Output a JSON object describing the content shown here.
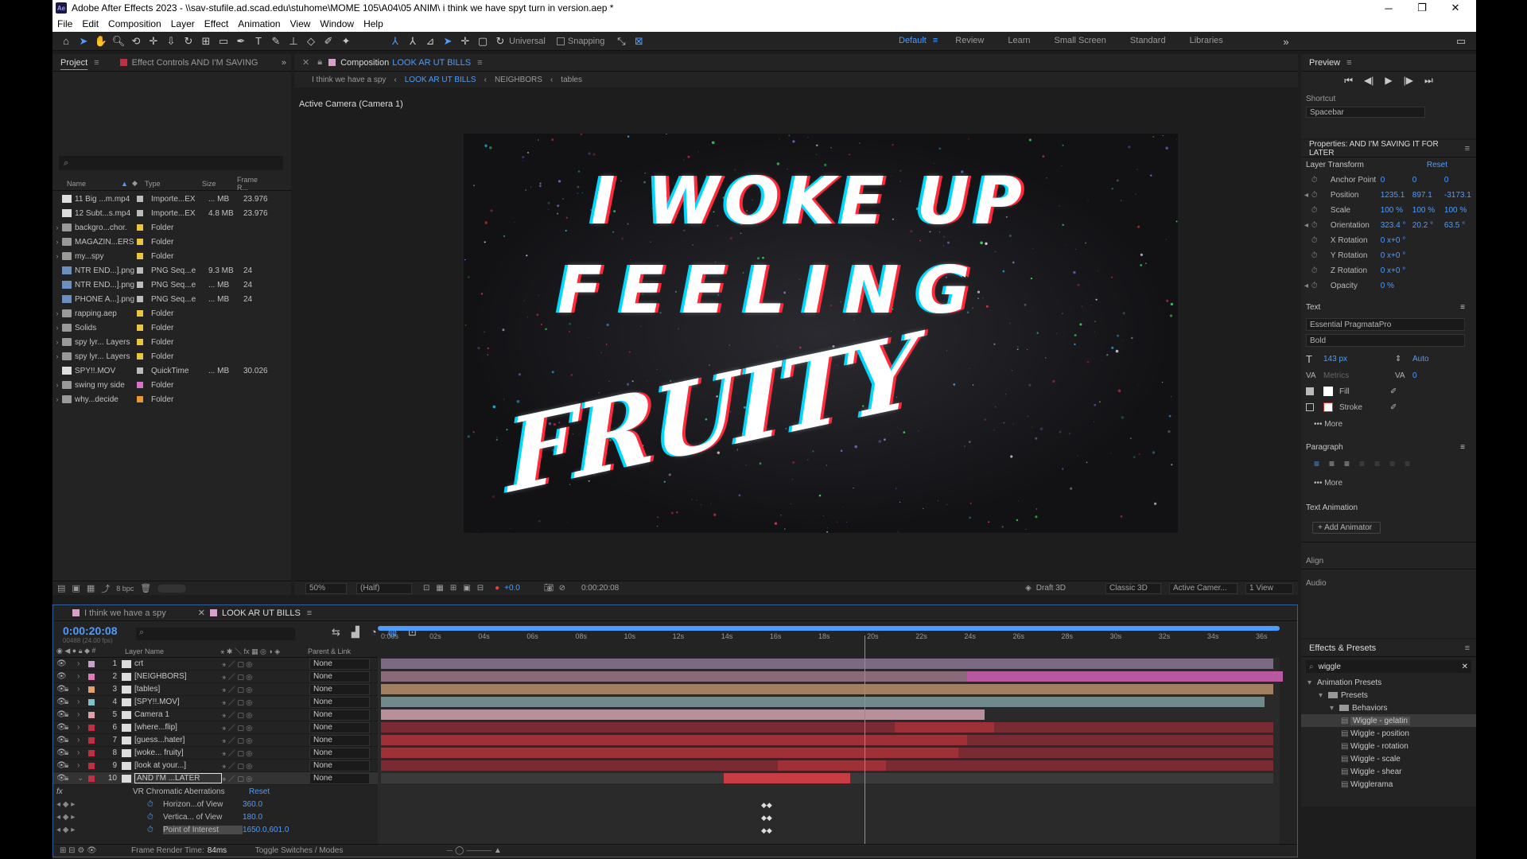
{
  "title": "Adobe After Effects 2023 - \\\\sav-stufile.ad.scad.edu\\stuhome\\MOME 105\\A04\\05 ANIM\\ i think we have spyt turn in version.aep *",
  "menu": [
    "File",
    "Edit",
    "Composition",
    "Layer",
    "Effect",
    "Animation",
    "View",
    "Window",
    "Help"
  ],
  "toolbar": {
    "universal": "Universal",
    "snapping": "Snapping"
  },
  "workspaces": [
    "Default",
    "Review",
    "Learn",
    "Small Screen",
    "Standard",
    "Libraries"
  ],
  "project": {
    "tab_project": "Project",
    "tab_effect": "Effect Controls AND I'M SAVING",
    "cols": {
      "name": "Name",
      "type": "Type",
      "size": "Size",
      "fr": "Frame R..."
    },
    "items": [
      {
        "name": "11 Big ...m.mp4",
        "type": "Importe...EX",
        "size": "... MB",
        "fr": "23.976",
        "kind": "file",
        "color": "#bcbcbc",
        "arrow": ""
      },
      {
        "name": "12 Subt...s.mp4",
        "type": "Importe...EX",
        "size": "4.8 MB",
        "fr": "23.976",
        "kind": "file",
        "color": "#bcbcbc",
        "arrow": ""
      },
      {
        "name": "backgro...chor.",
        "type": "Folder",
        "size": "",
        "fr": "",
        "kind": "folder",
        "color": "#e8c640",
        "arrow": "›"
      },
      {
        "name": "MAGAZIN...ERS",
        "type": "Folder",
        "size": "",
        "fr": "",
        "kind": "folder",
        "color": "#e8c640",
        "arrow": "›"
      },
      {
        "name": "my...spy",
        "type": "Folder",
        "size": "",
        "fr": "",
        "kind": "folder",
        "color": "#e8c640",
        "arrow": "›"
      },
      {
        "name": "NTR END...].png",
        "type": "PNG Seq...e",
        "size": "9.3 MB",
        "fr": "24",
        "kind": "png",
        "color": "#bcbcbc",
        "arrow": ""
      },
      {
        "name": "NTR END...].png",
        "type": "PNG Seq...e",
        "size": "... MB",
        "fr": "24",
        "kind": "png",
        "color": "#bcbcbc",
        "arrow": ""
      },
      {
        "name": "PHONE A...].png",
        "type": "PNG Seq...e",
        "size": "... MB",
        "fr": "24",
        "kind": "png",
        "color": "#bcbcbc",
        "arrow": ""
      },
      {
        "name": "rapping.aep",
        "type": "Folder",
        "size": "",
        "fr": "",
        "kind": "folder",
        "color": "#e8c640",
        "arrow": "›"
      },
      {
        "name": "Solids",
        "type": "Folder",
        "size": "",
        "fr": "",
        "kind": "folder",
        "color": "#e8c640",
        "arrow": "›"
      },
      {
        "name": "spy lyr... Layers",
        "type": "Folder",
        "size": "",
        "fr": "",
        "kind": "folder",
        "color": "#e8c640",
        "arrow": "›"
      },
      {
        "name": "spy lyr... Layers",
        "type": "Folder",
        "size": "",
        "fr": "",
        "kind": "folder",
        "color": "#e8c640",
        "arrow": "›"
      },
      {
        "name": "SPY!!.MOV",
        "type": "QuickTime",
        "size": "... MB",
        "fr": "30.026",
        "kind": "file",
        "color": "#bcbcbc",
        "arrow": ""
      },
      {
        "name": "swing my side",
        "type": "Folder",
        "size": "",
        "fr": "",
        "kind": "folder",
        "color": "#d870c8",
        "arrow": "›"
      },
      {
        "name": "why...decide",
        "type": "Folder",
        "size": "",
        "fr": "",
        "kind": "folder",
        "color": "#e89a30",
        "arrow": "›"
      }
    ],
    "bpc": "8 bpc"
  },
  "comp": {
    "header": "Composition",
    "name": "LOOK AR UT BILLS",
    "crumbs": [
      "I think we have a spy",
      "LOOK AR UT BILLS",
      "NEIGHBORS",
      "tables"
    ],
    "camera": "Active Camera (Camera 1)",
    "line1": "I WOKE UP",
    "line2": "FEELING",
    "line3": "FRUITY",
    "zoom": "50%",
    "res": "(Half)",
    "exposure": "+0.0",
    "timecode": "0:00:20:08",
    "draft": "Draft 3D",
    "renderer": "Classic 3D",
    "cam": "Active Camer...",
    "views": "1 View"
  },
  "preview": {
    "title": "Preview",
    "shortcut_label": "Shortcut",
    "shortcut": "Spacebar"
  },
  "properties": {
    "title": "Properties: AND I'M SAVING IT FOR LATER",
    "transform": "Layer Transform",
    "reset": "Reset",
    "rows": [
      {
        "name": "Anchor Point",
        "v1": "0",
        "v2": "0",
        "v3": "0"
      },
      {
        "name": "Position",
        "v1": "1235.1",
        "v2": "897.1",
        "v3": "-3173.1"
      },
      {
        "name": "Scale",
        "v1": "100 %",
        "v2": "100 %",
        "v3": "100 %"
      },
      {
        "name": "Orientation",
        "v1": "323.4 °",
        "v2": "20.2 °",
        "v3": "63.5 °"
      },
      {
        "name": "X Rotation",
        "v1": "0 x+0 °",
        "v2": "",
        "v3": ""
      },
      {
        "name": "Y Rotation",
        "v1": "0 x+0 °",
        "v2": "",
        "v3": ""
      },
      {
        "name": "Z Rotation",
        "v1": "0 x+0 °",
        "v2": "",
        "v3": ""
      },
      {
        "name": "Opacity",
        "v1": "0 %",
        "v2": "",
        "v3": ""
      }
    ],
    "text_title": "Text",
    "font": "Essential PragmataPro",
    "style": "Bold",
    "size": "143 px",
    "leading": "Auto",
    "kerning": "Metrics",
    "tracking": "0",
    "fill": "Fill",
    "stroke": "Stroke",
    "more": "More",
    "paragraph": "Paragraph",
    "text_anim": "Text Animation",
    "add_animator": "Add Animator",
    "align": "Align",
    "audio": "Audio"
  },
  "effects": {
    "title": "Effects & Presets",
    "search": "wiggle",
    "tree": [
      {
        "label": "Animation Presets",
        "indent": 0
      },
      {
        "label": "Presets",
        "indent": 1
      },
      {
        "label": "Behaviors",
        "indent": 2
      },
      {
        "label": "Wiggle - gelatin",
        "indent": 3
      },
      {
        "label": "Wiggle - position",
        "indent": 3
      },
      {
        "label": "Wiggle - rotation",
        "indent": 3
      },
      {
        "label": "Wiggle - scale",
        "indent": 3
      },
      {
        "label": "Wiggle - shear",
        "indent": 3
      },
      {
        "label": "Wigglerama",
        "indent": 3
      }
    ]
  },
  "timeline": {
    "tabs": [
      "I think we have a spy",
      "LOOK AR UT BILLS"
    ],
    "timecode": "0:00:20:08",
    "frames": "00488 (24.00 fps)",
    "cols": {
      "layer": "Layer Name",
      "parent": "Parent & Link"
    },
    "ruler": [
      "0:00s",
      "02s",
      "04s",
      "06s",
      "08s",
      "10s",
      "12s",
      "14s",
      "16s",
      "18s",
      "20s",
      "22s",
      "24s",
      "26s",
      "28s",
      "30s",
      "32s",
      "34s",
      "36s"
    ],
    "layers": [
      {
        "n": "1",
        "name": "crt",
        "color": "#c8a0c8",
        "parent": "None",
        "start": 0.0,
        "end": 1.0,
        "bar": "#7a6a82"
      },
      {
        "n": "2",
        "name": "[NEIGHBORS]",
        "color": "#e07ab8",
        "parent": "None",
        "start": 0.0,
        "end": 1.0,
        "bar": "#8a6a7a",
        "bar2": "#b858a0",
        "s2": 0.65
      },
      {
        "n": "3",
        "name": "[tables]",
        "color": "#e0a070",
        "parent": "None",
        "start": 0.0,
        "end": 1.0,
        "bar": "#a08060"
      },
      {
        "n": "4",
        "name": "[SPY!!.MOV]",
        "color": "#80c0c8",
        "parent": "None",
        "start": 0.0,
        "end": 0.99,
        "bar": "#708a8c"
      },
      {
        "n": "5",
        "name": "Camera 1",
        "color": "#e0a0a8",
        "parent": "None",
        "start": 0.0,
        "end": 0.68,
        "bar": "#b8909a"
      },
      {
        "n": "6",
        "name": "[where...flip]",
        "color": "#c03040",
        "parent": "None",
        "start": 0.0,
        "end": 1.0,
        "bar": "#7a2a32",
        "bar2": "#a03038",
        "s2": 0.57,
        "e2": 0.68
      },
      {
        "n": "7",
        "name": "[guess...hater]",
        "color": "#c03040",
        "parent": "None",
        "start": 0.0,
        "end": 1.0,
        "bar": "#7a2a32",
        "bar2": "#a03038",
        "s2": 0.0,
        "e2": 0.65
      },
      {
        "n": "8",
        "name": "[woke... fruity]",
        "color": "#c03040",
        "parent": "None",
        "start": 0.0,
        "end": 1.0,
        "bar": "#7a2a32",
        "bar2": "#a03038",
        "s2": 0.0,
        "e2": 0.64
      },
      {
        "n": "9",
        "name": "[look at your...]",
        "color": "#c03040",
        "parent": "None",
        "start": 0.0,
        "end": 1.0,
        "bar": "#7a2a32",
        "bar2": "#a03038",
        "s2": 0.44,
        "e2": 0.56
      },
      {
        "n": "10",
        "name": "AND I'M ...LATER",
        "color": "#c03040",
        "parent": "None",
        "start": 0.0,
        "end": 1.0,
        "bar": "#3a3a3a",
        "bar2": "#c83c44",
        "s2": 0.38,
        "e2": 0.52
      }
    ],
    "effect": "VR Chromatic Aberrations",
    "effect_reset": "Reset",
    "subprops": [
      {
        "name": "Horizon...of View",
        "val": "360.0"
      },
      {
        "name": "Vertica... of View",
        "val": "180.0"
      },
      {
        "name": "Point of Interest",
        "val": "1650.0,601.0"
      }
    ],
    "fx": "fx",
    "render_time_label": "Frame Render Time:",
    "render_time": "84ms",
    "toggle": "Toggle Switches / Modes",
    "playhead": 0.54
  }
}
